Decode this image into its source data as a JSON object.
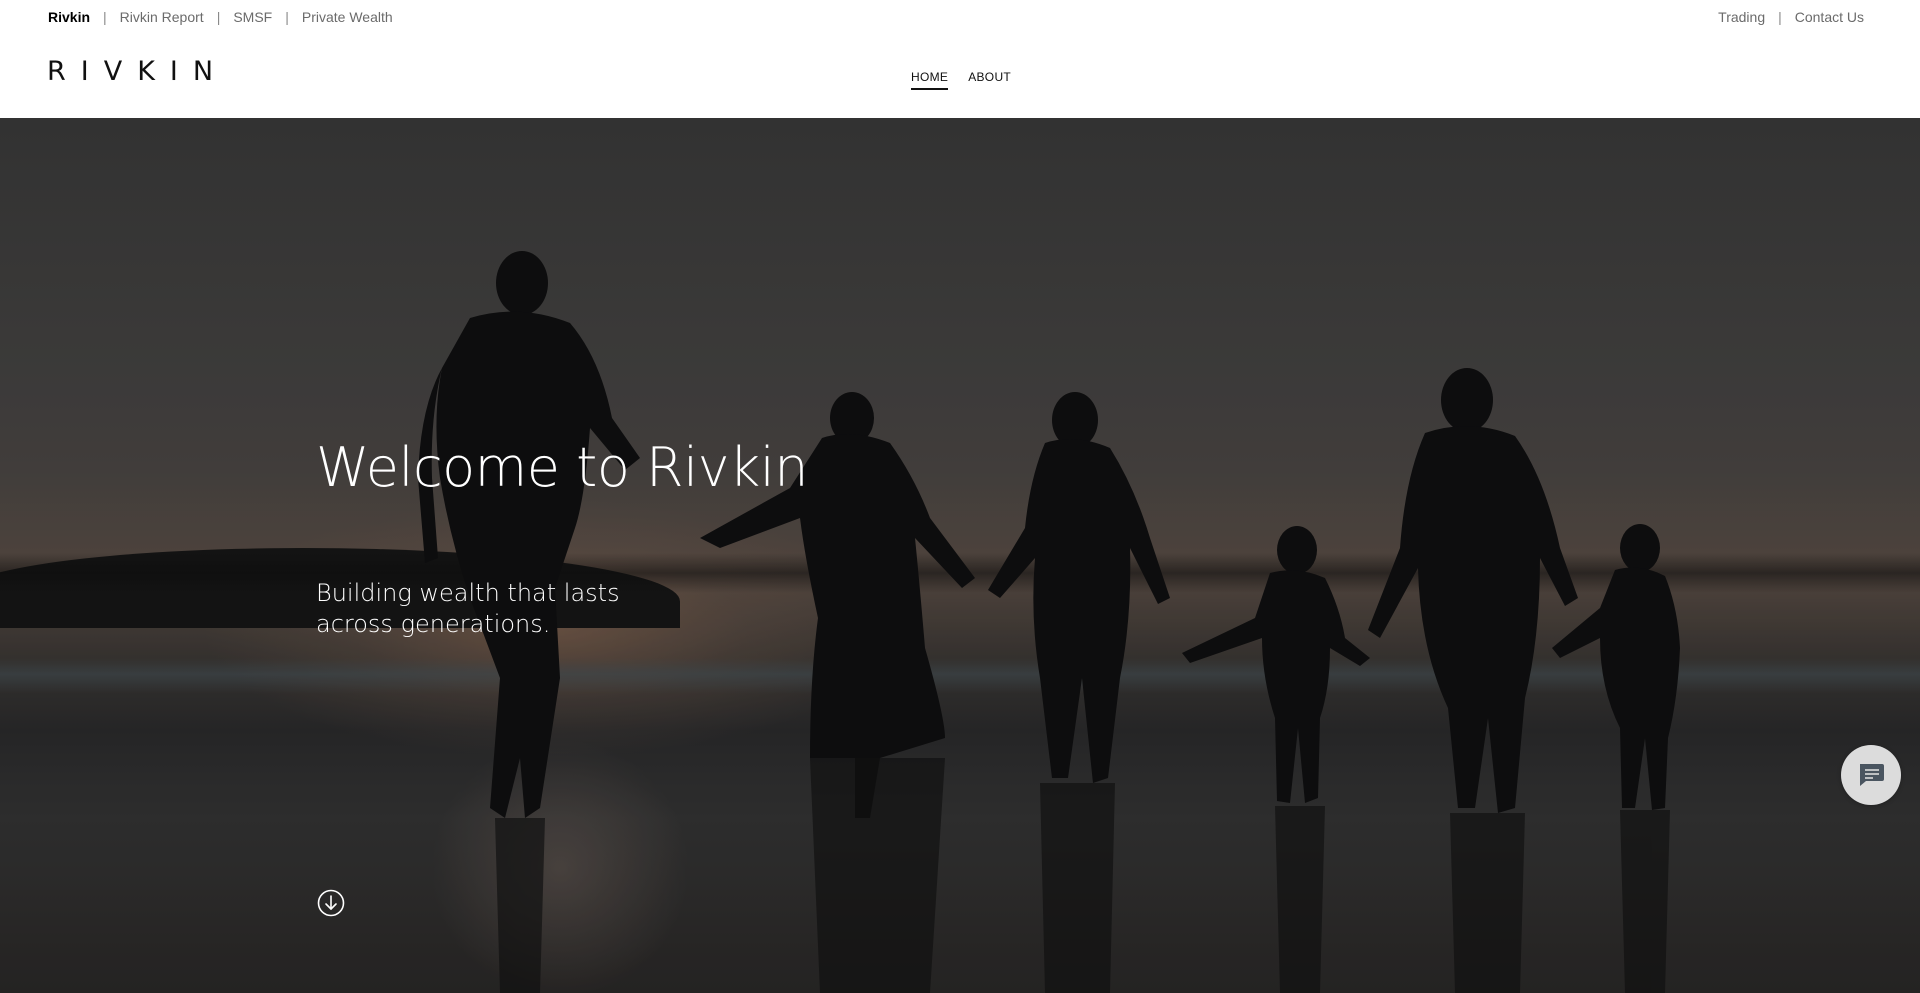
{
  "utility_bar": {
    "left_links": [
      {
        "label": "Rivkin",
        "active": true
      },
      {
        "label": "Rivkin Report",
        "active": false
      },
      {
        "label": "SMSF",
        "active": false
      },
      {
        "label": "Private Wealth",
        "active": false
      }
    ],
    "right_links": [
      {
        "label": "Trading"
      },
      {
        "label": "Contact Us"
      }
    ],
    "separator": "|"
  },
  "header": {
    "logo_text": "RIVKIN",
    "nav": [
      {
        "label": "HOME",
        "active": true
      },
      {
        "label": "ABOUT",
        "active": false
      }
    ]
  },
  "hero": {
    "title": "Welcome to Rivkin",
    "subtitle": "Building wealth that lasts across generations.",
    "scroll_icon": "arrow-down-circle-icon",
    "chat_icon": "chat-bubble-icon"
  },
  "colors": {
    "text_dark": "#111111",
    "text_muted": "#6b6b6b",
    "hero_text": "#ffffff",
    "chat_button_bg": "#dcdcdc",
    "chat_icon": "#4a5560"
  }
}
